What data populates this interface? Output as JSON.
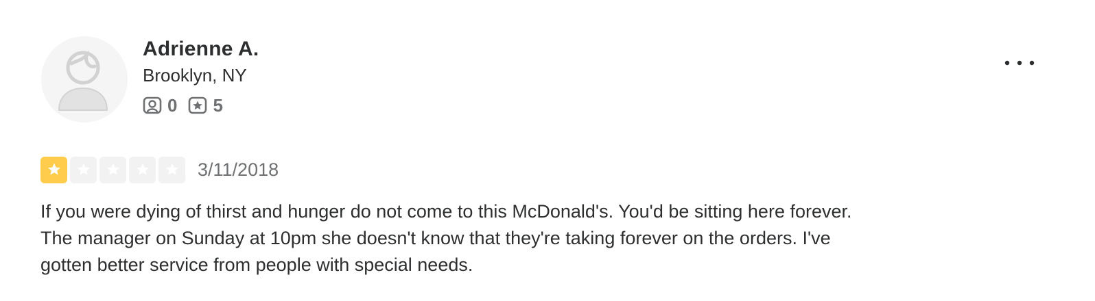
{
  "user": {
    "name": "Adrienne A.",
    "location": "Brooklyn, NY",
    "friends_icon": "friends-icon",
    "friends_count": "0",
    "reviews_icon": "review-star-icon",
    "reviews_count": "5",
    "avatar_icon": "default-avatar-icon"
  },
  "review": {
    "rating": 1,
    "max_rating": 5,
    "date": "3/11/2018",
    "text_lines": [
      "If you were dying of thirst and hunger do not come to this McDonald's. You'd be sitting here forever.",
      "The manager on Sunday at 10pm she doesn't know that they're taking forever on the orders. I've",
      "gotten better service from people with special needs."
    ]
  },
  "more_menu": {
    "icon": "more-options-icon"
  },
  "colors": {
    "star_filled": "#ffcc4b",
    "star_empty": "#f2f2f2",
    "text_primary": "#2d2e2f",
    "text_secondary": "#6e7072"
  }
}
